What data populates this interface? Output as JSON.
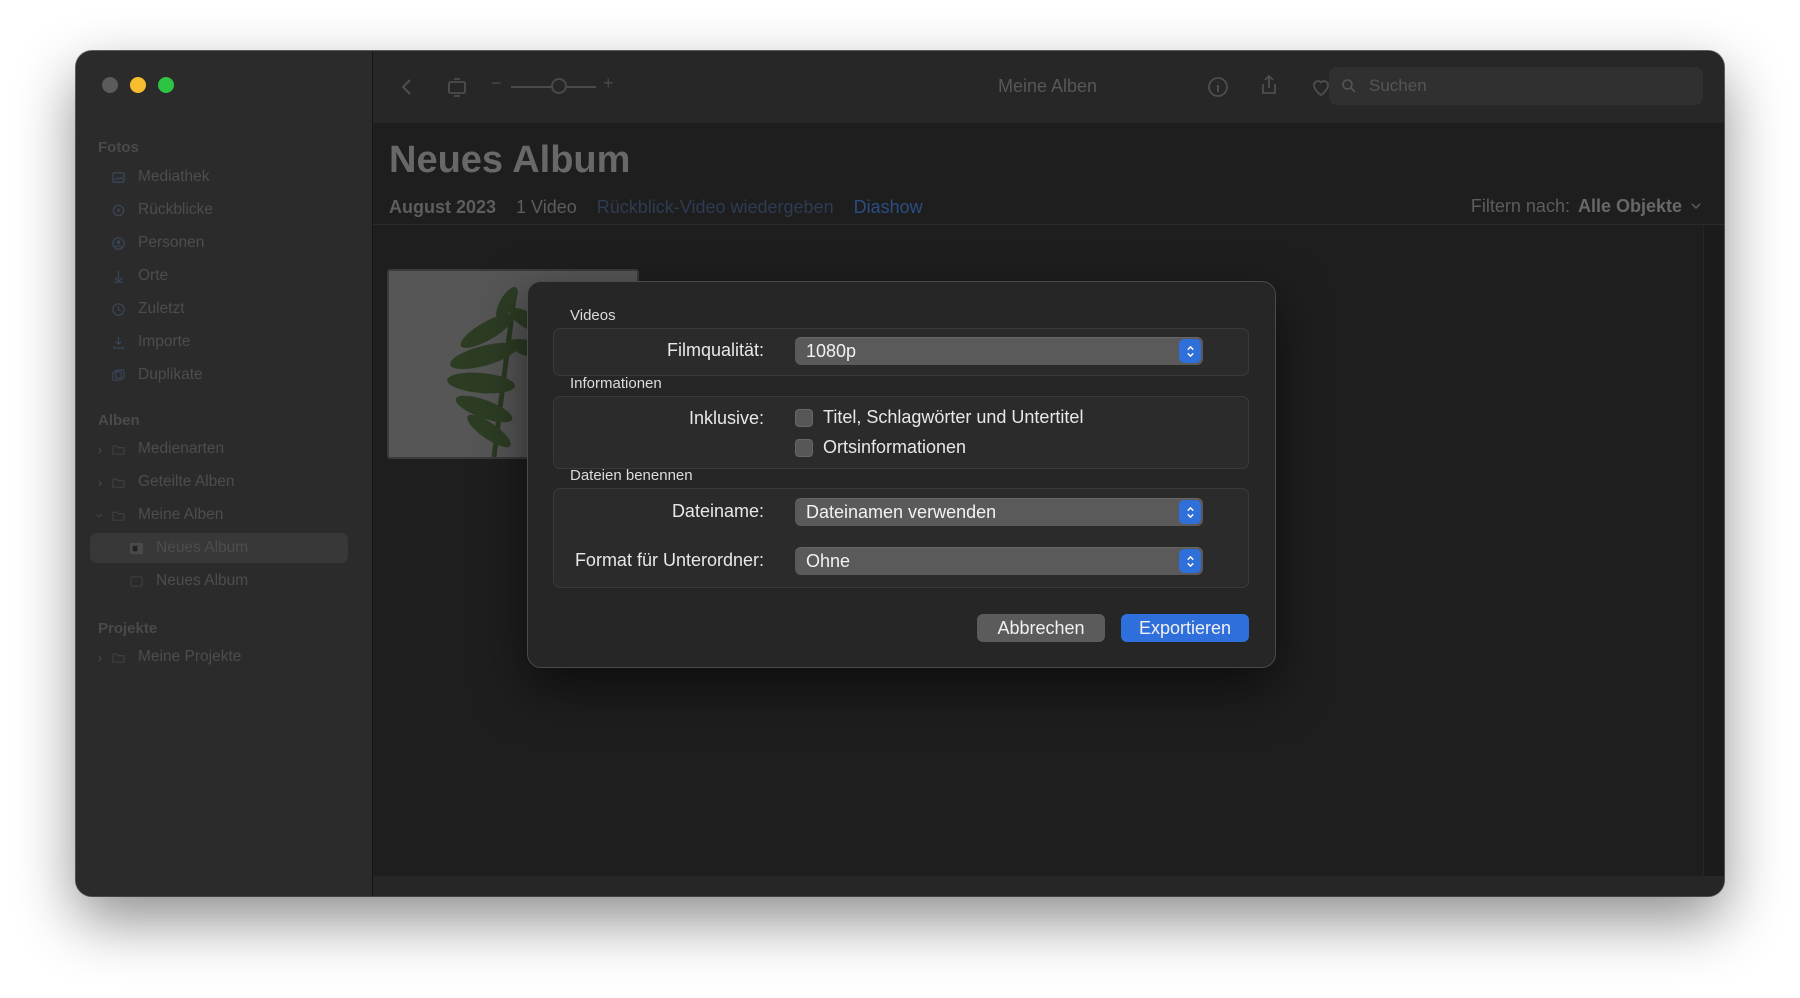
{
  "sidebar": {
    "sections": {
      "fotos": "Fotos",
      "alben": "Alben",
      "projekte": "Projekte"
    },
    "fotos_items": [
      {
        "label": "Mediathek",
        "icon": "library-icon"
      },
      {
        "label": "Rückblicke",
        "icon": "memories-icon"
      },
      {
        "label": "Personen",
        "icon": "people-icon"
      },
      {
        "label": "Orte",
        "icon": "places-icon"
      },
      {
        "label": "Zuletzt",
        "icon": "recent-icon"
      },
      {
        "label": "Importe",
        "icon": "imports-icon"
      },
      {
        "label": "Duplikate",
        "icon": "duplicates-icon"
      }
    ],
    "alben_items": [
      {
        "label": "Medienarten",
        "icon": "folder-icon",
        "chevron": "right"
      },
      {
        "label": "Geteilte Alben",
        "icon": "folder-icon",
        "chevron": "right"
      },
      {
        "label": "Meine Alben",
        "icon": "folder-icon",
        "chevron": "down"
      },
      {
        "label": "Neues Album",
        "icon": "album-icon",
        "selected": true
      },
      {
        "label": "Neues Album",
        "icon": "album-icon",
        "selected": false
      }
    ],
    "projekte_items": [
      {
        "label": "Meine Projekte",
        "icon": "folder-icon",
        "chevron": "right"
      }
    ]
  },
  "toolbar": {
    "title": "Meine Alben",
    "zoom_minus": "−",
    "zoom_plus": "+",
    "search_placeholder": "Suchen"
  },
  "album": {
    "title": "Neues Album",
    "date": "August 2023",
    "count": "1 Video",
    "memory_link": "Rückblick-Video wiedergeben",
    "slideshow_link": "Diashow",
    "filter_label": "Filtern nach:",
    "filter_value": "Alle Objekte"
  },
  "dialog": {
    "videos_label": "Videos",
    "quality_label": "Filmqualität:",
    "quality_value": "1080p",
    "info_label": "Informationen",
    "include_label": "Inklusive:",
    "checkbox_titles": "Titel, Schlagwörter und Untertitel",
    "checkbox_location": "Ortsinformationen",
    "naming_label": "Dateien benennen",
    "filename_label": "Dateiname:",
    "filename_value": "Dateinamen verwenden",
    "subfolder_label": "Format für Unterordner:",
    "subfolder_value": "Ohne",
    "cancel_label": "Abbrechen",
    "export_label": "Exportieren"
  },
  "colors": {
    "accent": "#2e6fdc",
    "close": "#5b5b5b",
    "minimize": "#f6be2f",
    "maximize": "#2dc443"
  }
}
